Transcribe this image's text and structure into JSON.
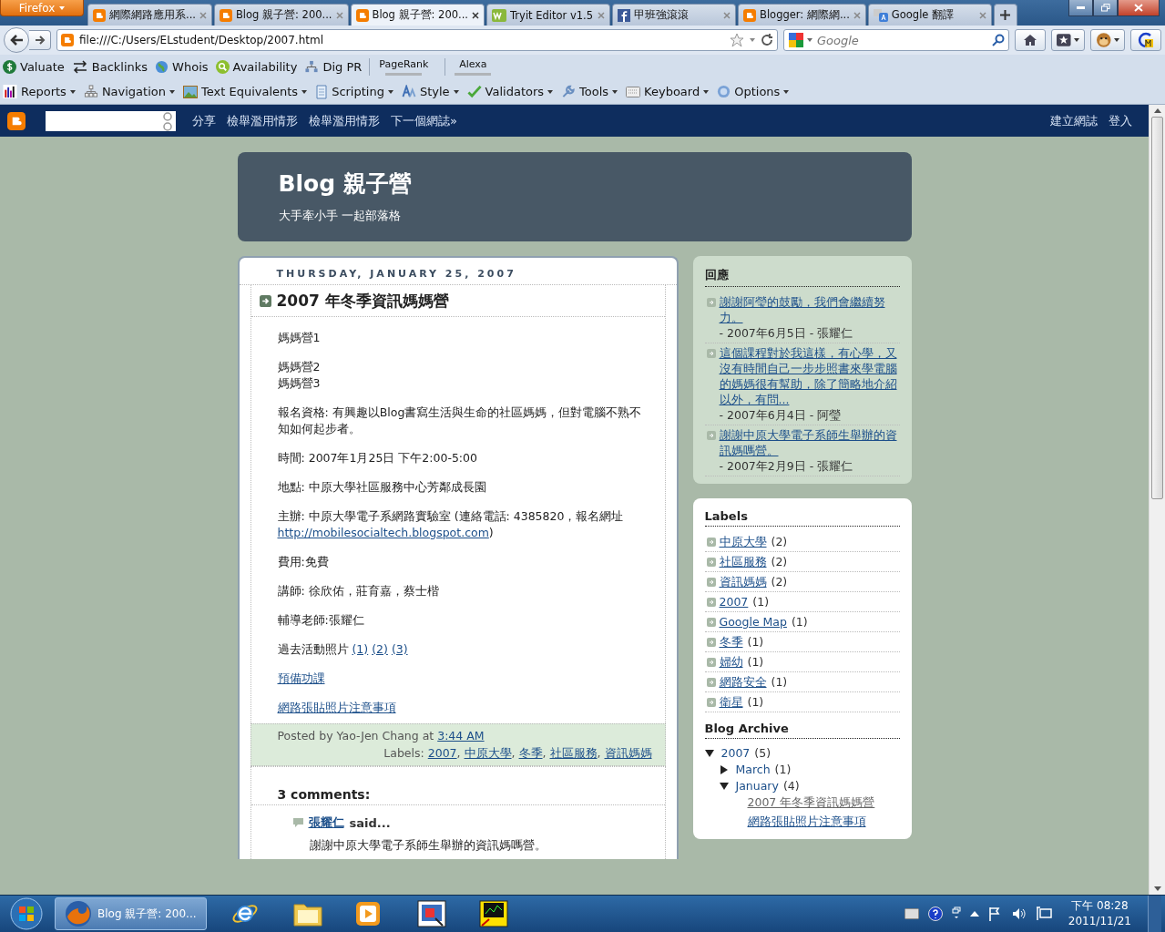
{
  "browser": {
    "menu_button": "Firefox",
    "tabs": [
      {
        "title": "網際網路應用系...",
        "kind": "blogger",
        "selected": false
      },
      {
        "title": "Blog 親子營: 200...",
        "kind": "blogger",
        "selected": false
      },
      {
        "title": "Blog 親子營: 200...",
        "kind": "blogger",
        "selected": true
      },
      {
        "title": "Tryit Editor v1.5",
        "kind": "tryit",
        "selected": false
      },
      {
        "title": "甲班強滾滾",
        "kind": "facebook",
        "selected": false
      },
      {
        "title": "Blogger: 網際網...",
        "kind": "blogger",
        "selected": false
      },
      {
        "title": "Google 翻譯",
        "kind": "translate",
        "selected": false
      }
    ],
    "address": "file:///C:/Users/ELstudent/Desktop/2007.html",
    "search": {
      "placeholder": "Google"
    },
    "seo_toolbar": [
      {
        "label": "Valuate",
        "kind": "dollar"
      },
      {
        "label": "Backlinks",
        "kind": "arrows"
      },
      {
        "label": "Whois",
        "kind": "globe"
      },
      {
        "label": "Availability",
        "kind": "magnifier"
      },
      {
        "label": "Dig PR",
        "kind": "network"
      }
    ],
    "rank_meters": [
      "PageRank",
      "Alexa"
    ],
    "dev_toolbar": [
      {
        "label": "Reports",
        "kind": "chart"
      },
      {
        "label": "Navigation",
        "kind": "sitemap"
      },
      {
        "label": "Text Equivalents",
        "kind": "picture"
      },
      {
        "label": "Scripting",
        "kind": "scroll"
      },
      {
        "label": "Style",
        "kind": "style"
      },
      {
        "label": "Validators",
        "kind": "check"
      },
      {
        "label": "Tools",
        "kind": "wrench"
      },
      {
        "label": "Keyboard",
        "kind": "keyboard"
      },
      {
        "label": "Options",
        "kind": "help"
      }
    ]
  },
  "blogger_bar": {
    "links": [
      "分享",
      "檢舉濫用情形",
      "檢舉濫用情形",
      "下一個網誌»"
    ],
    "right_links": [
      "建立網誌",
      "登入"
    ]
  },
  "blog": {
    "title": "Blog 親子營",
    "description": "大手牽小手 一起部落格"
  },
  "post": {
    "date": "THURSDAY, JANUARY 25, 2007",
    "title": "2007 年冬季資訊媽媽營",
    "body": [
      {
        "lines": [
          [
            {
              "kind": "text",
              "text": "媽媽營1"
            }
          ]
        ]
      },
      {
        "lines": [
          [
            {
              "kind": "text",
              "text": "媽媽營2"
            }
          ],
          [
            {
              "kind": "text",
              "text": "媽媽營3"
            }
          ]
        ]
      },
      {
        "lines": [
          [
            {
              "kind": "text",
              "text": "報名資格: 有興趣以Blog書寫生活與生命的社區媽媽，但對電腦不熟不知如何起步者。"
            }
          ]
        ]
      },
      {
        "lines": [
          [
            {
              "kind": "text",
              "text": "時間: 2007年1月25日 下午2:00-5:00"
            }
          ]
        ]
      },
      {
        "lines": [
          [
            {
              "kind": "text",
              "text": "地點: 中原大學社區服務中心芳鄰成長園"
            }
          ]
        ]
      },
      {
        "lines": [
          [
            {
              "kind": "text",
              "text": "主辦: 中原大學電子系網路實驗室 (連絡電話: 4385820，報名網址"
            },
            {
              "kind": "link",
              "text": "http://mobilesocialtech.blogspot.com"
            },
            {
              "kind": "text",
              "text": ")"
            }
          ]
        ]
      },
      {
        "lines": [
          [
            {
              "kind": "text",
              "text": "費用:免費"
            }
          ]
        ]
      },
      {
        "lines": [
          [
            {
              "kind": "text",
              "text": "講師: 徐欣佑，莊育嘉，蔡士楷"
            }
          ]
        ]
      },
      {
        "lines": [
          [
            {
              "kind": "text",
              "text": "輔導老師:張耀仁"
            }
          ]
        ]
      },
      {
        "lines": [
          [
            {
              "kind": "text",
              "text": "過去活動照片"
            },
            {
              "kind": "link",
              "text": "(1)"
            },
            {
              "kind": "link",
              "text": "(2)"
            },
            {
              "kind": "link",
              "text": "(3)"
            }
          ]
        ]
      },
      {
        "lines": [
          [
            {
              "kind": "link",
              "text": "預備功課"
            }
          ]
        ]
      },
      {
        "lines": [
          [
            {
              "kind": "link",
              "text": "網路張貼照片注意事項"
            }
          ]
        ]
      }
    ],
    "footer": {
      "posted_by": "Posted by Yao-Jen Chang at",
      "time": "3:44 AM",
      "labels_caption": "Labels:",
      "separator": ",",
      "labels": [
        "2007",
        "中原大學",
        "冬季",
        "社區服務",
        "資訊媽媽"
      ]
    },
    "comments": {
      "heading": "3 comments:",
      "items": [
        {
          "author": "張耀仁",
          "said": "said...",
          "text": "謝謝中原大學電子系師生舉辦的資訊媽嗎營。"
        }
      ]
    }
  },
  "sidebar": {
    "recent_comments": {
      "title": "回應",
      "items": [
        {
          "link": "謝謝阿瑩的鼓勵，我們會繼續努力。",
          "meta": "- 2007年6月5日 - 張耀仁"
        },
        {
          "link": "這個課程對於我這樣，有心學，又沒有時間自己一步步照書來學電腦的媽媽很有幫助，除了簡略地介紹以外，有問...",
          "meta": "- 2007年6月4日 - 阿瑩"
        },
        {
          "link": "謝謝中原大學電子系師生舉辦的資訊媽嗎營。",
          "meta": "- 2007年2月9日 - 張耀仁"
        }
      ]
    },
    "labels": {
      "title": "Labels",
      "items": [
        {
          "name": "中原大學",
          "count": "(2)"
        },
        {
          "name": "社區服務",
          "count": "(2)"
        },
        {
          "name": "資訊媽媽",
          "count": "(2)"
        },
        {
          "name": "2007",
          "count": "(1)"
        },
        {
          "name": "Google Map",
          "count": "(1)"
        },
        {
          "name": "冬季",
          "count": "(1)"
        },
        {
          "name": "婦幼",
          "count": "(1)"
        },
        {
          "name": "網路安全",
          "count": "(1)"
        },
        {
          "name": "衛星",
          "count": "(1)"
        }
      ]
    },
    "archive": {
      "title": "Blog Archive",
      "items": [
        {
          "label": "2007",
          "count": "(5)",
          "expanded": true,
          "children": [
            {
              "label": "March",
              "count": "(1)",
              "expanded": false
            },
            {
              "label": "January",
              "count": "(4)",
              "expanded": true,
              "posts": [
                {
                  "title": "2007 年冬季資訊媽媽營",
                  "selected": true
                },
                {
                  "title": "網路張貼照片注意事項",
                  "selected": false
                }
              ]
            }
          ]
        }
      ]
    }
  },
  "taskbar": {
    "apps": [
      {
        "kind": "firefox",
        "label": "Blog 親子營: 200...",
        "selected": true
      },
      {
        "kind": "ie",
        "selected": false
      },
      {
        "kind": "folder",
        "selected": false
      },
      {
        "kind": "media",
        "selected": false
      },
      {
        "kind": "capture",
        "selected": false
      },
      {
        "kind": "board",
        "selected": false
      }
    ],
    "clock": {
      "time": "下午 08:28",
      "date": "2011/11/21"
    }
  }
}
